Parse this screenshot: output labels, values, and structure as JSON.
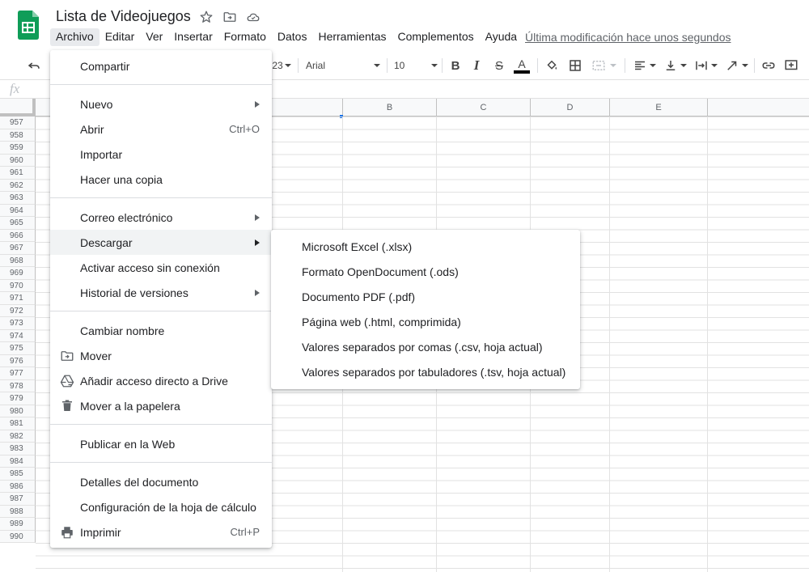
{
  "doc": {
    "title": "Lista de Videojuegos",
    "last_modified": "Última modificación hace unos segundos"
  },
  "menubar": [
    "Archivo",
    "Editar",
    "Ver",
    "Insertar",
    "Formato",
    "Datos",
    "Herramientas",
    "Complementos",
    "Ayuda"
  ],
  "active_menu": "Archivo",
  "toolbar": {
    "number_format_fragment": "23",
    "font": "Arial",
    "font_size": "10",
    "bold": "B",
    "italic": "I",
    "strike": "S",
    "text_color": "A",
    "text_color_value": "#000000"
  },
  "formula_bar": {
    "fx": "fx"
  },
  "grid": {
    "columns": [
      "B",
      "C",
      "D",
      "E"
    ],
    "rows": [
      "957",
      "958",
      "959",
      "960",
      "961",
      "962",
      "963",
      "964",
      "965",
      "966",
      "967",
      "968",
      "969",
      "970",
      "971",
      "972",
      "973",
      "974",
      "975",
      "976",
      "977",
      "978",
      "979",
      "980",
      "981",
      "982",
      "983",
      "984",
      "985",
      "986",
      "987",
      "988",
      "989",
      "990"
    ]
  },
  "file_menu": {
    "items": [
      {
        "label": "Compartir"
      },
      {
        "sep": true
      },
      {
        "label": "Nuevo",
        "submenu": true
      },
      {
        "label": "Abrir",
        "shortcut": "Ctrl+O"
      },
      {
        "label": "Importar"
      },
      {
        "label": "Hacer una copia"
      },
      {
        "sep": true
      },
      {
        "label": "Correo electrónico",
        "submenu": true
      },
      {
        "label": "Descargar",
        "submenu": true,
        "highlighted": true
      },
      {
        "label": "Activar acceso sin conexión"
      },
      {
        "label": "Historial de versiones",
        "submenu": true
      },
      {
        "sep": true
      },
      {
        "label": "Cambiar nombre"
      },
      {
        "label": "Mover",
        "icon": "move-folder-icon"
      },
      {
        "label": "Añadir acceso directo a Drive",
        "icon": "drive-shortcut-icon"
      },
      {
        "label": "Mover a la papelera",
        "icon": "trash-icon"
      },
      {
        "sep": true
      },
      {
        "label": "Publicar en la Web"
      },
      {
        "sep": true
      },
      {
        "label": "Detalles del documento"
      },
      {
        "label": "Configuración de la hoja de cálculo"
      },
      {
        "label": "Imprimir",
        "shortcut": "Ctrl+P",
        "icon": "print-icon"
      }
    ]
  },
  "download_submenu": {
    "items": [
      "Microsoft Excel (.xlsx)",
      "Formato OpenDocument (.ods)",
      "Documento PDF (.pdf)",
      "Página web (.html, comprimida)",
      "Valores separados por comas (.csv, hoja actual)",
      "Valores separados por tabuladores (.tsv, hoja actual)"
    ]
  },
  "colors": {
    "sheets_green": "#0f9d58",
    "menu_hover": "#f1f3f4",
    "selection_blue": "#1a73e8"
  }
}
